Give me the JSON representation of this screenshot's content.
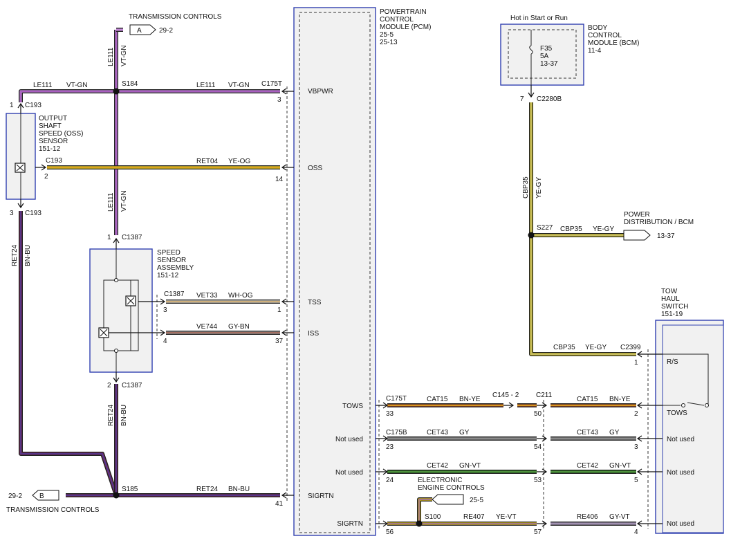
{
  "pcm": {
    "name": "POWERTRAIN",
    "name2": "CONTROL",
    "name3": "MODULE (PCM)",
    "ref1": "25-5",
    "ref2": "25-13"
  },
  "bcm": {
    "title": "Hot in Start or Run",
    "name": "BODY",
    "name2": "CONTROL",
    "name3": "MODULE (BCM)",
    "ref": "11-4",
    "fuse": "F35",
    "amps": "5A",
    "fuse_ref": "13-37"
  },
  "oss": {
    "name": "OUTPUT",
    "name2": "SHAFT",
    "name3": "SPEED (OSS)",
    "name4": "SENSOR",
    "ref": "151-12"
  },
  "ssa": {
    "name": "SPEED",
    "name2": "SENSOR",
    "name3": "ASSEMBLY",
    "ref": "151-12"
  },
  "tow": {
    "name": "TOW",
    "name2": "HAUL",
    "name3": "SWITCH",
    "ref": "151-19",
    "rs": "R/S",
    "tows": "TOWS",
    "nu1": "Not used",
    "nu2": "Not used",
    "nu3": "Not used"
  },
  "offpage": {
    "a_label": "A",
    "a_ref": "29-2",
    "a_title": "TRANSMISSION CONTROLS",
    "b_label": "B",
    "b_ref": "29-2",
    "b_title": "TRANSMISSION CONTROLS",
    "pd_title": "POWER",
    "pd_title2": "DISTRIBUTION / BCM",
    "pd_ref": "13-37",
    "eec_title": "ELECTRONIC",
    "eec_title2": "ENGINE CONTROLS",
    "eec_ref": "25-5"
  },
  "pins": {
    "vbpwr": "VBPWR",
    "oss": "OSS",
    "tss": "TSS",
    "iss": "ISS",
    "sigrtn": "SIGRTN",
    "tows": "TOWS",
    "nu1": "Not used",
    "nu2": "Not used",
    "sigrtn2": "SIGRTN"
  },
  "splices": {
    "s184": "S184",
    "s185": "S185",
    "s227": "S227",
    "s100": "S100"
  },
  "conn": {
    "c193a": "C193",
    "c193b": "C193",
    "c193c": "C193",
    "c175t": "C175T",
    "c1387a": "C1387",
    "c1387b": "C1387",
    "c1387c": "C1387",
    "c2280b": "C2280B",
    "c2399": "C2399",
    "c175t2": "C175T",
    "c145": "C145 - 2",
    "c211": "C211",
    "c175b": "C175B"
  },
  "pinnums": {
    "p1": "1",
    "p3a": "3",
    "p2a": "2",
    "p14": "14",
    "p3b": "3",
    "p1b": "1",
    "p1c": "1",
    "p3c": "3",
    "p4": "4",
    "p37": "37",
    "p2b": "2",
    "p41": "41",
    "p7": "7",
    "p1d": "1",
    "p33": "33",
    "p50": "50",
    "p2c": "2",
    "p23": "23",
    "p54": "54",
    "p3d": "3",
    "p24": "24",
    "p53": "53",
    "p5": "5",
    "p56": "56",
    "p57": "57",
    "p4b": "4"
  },
  "wires": {
    "le111_a": "LE111",
    "le111_a_c": "VT-GN",
    "le111_b": "LE111",
    "le111_b_c": "VT-GN",
    "le111_c": "LE111",
    "le111_c_c": "VT-GN",
    "le111_d": "LE111",
    "le111_d_c": "VT-GN",
    "ret04": "RET04",
    "ret04_c": "YE-OG",
    "vet33": "VET33",
    "vet33_c": "WH-OG",
    "ve744": "VE744",
    "ve744_c": "GY-BN",
    "ret24_a": "RET24",
    "ret24_a_c": "BN-BU",
    "ret24_b": "RET24",
    "ret24_b_c": "BN-BU",
    "ret24_c": "RET24",
    "ret24_c_c": "BN-BU",
    "cbp35_a": "CBP35",
    "cbp35_a_c": "YE-GY",
    "cbp35_b": "CBP35",
    "cbp35_b_c": "YE-GY",
    "cbp35_c": "CBP35",
    "cbp35_c_c": "YE-GY",
    "cat15_a": "CAT15",
    "cat15_a_c": "BN-YE",
    "cat15_b": "CAT15",
    "cat15_b_c": "BN-YE",
    "cet43_a": "CET43",
    "cet43_a_c": "GY",
    "cet43_b": "CET43",
    "cet43_b_c": "GY",
    "cet42_a": "CET42",
    "cet42_a_c": "GN-VT",
    "cet42_b": "CET42",
    "cet42_b_c": "GN-VT",
    "re407": "RE407",
    "re407_c": "YE-VT",
    "re406": "RE406",
    "re406_c": "GY-VT"
  },
  "colors": {
    "vt_gn": "#c48ad8",
    "ye_og": "#f2dc2a",
    "wh_og": "#d8d4c4",
    "gy_bn": "#b07060",
    "bn_bu": "#6a2a4a",
    "ye_gy": "#f0e030",
    "bn_ye": "#a04a22",
    "gy": "#888888",
    "gn_vt": "#2e7a22",
    "ye_vt": "#e8c820",
    "gy_vt": "#9a80a8",
    "module_border": "#3040b0"
  }
}
